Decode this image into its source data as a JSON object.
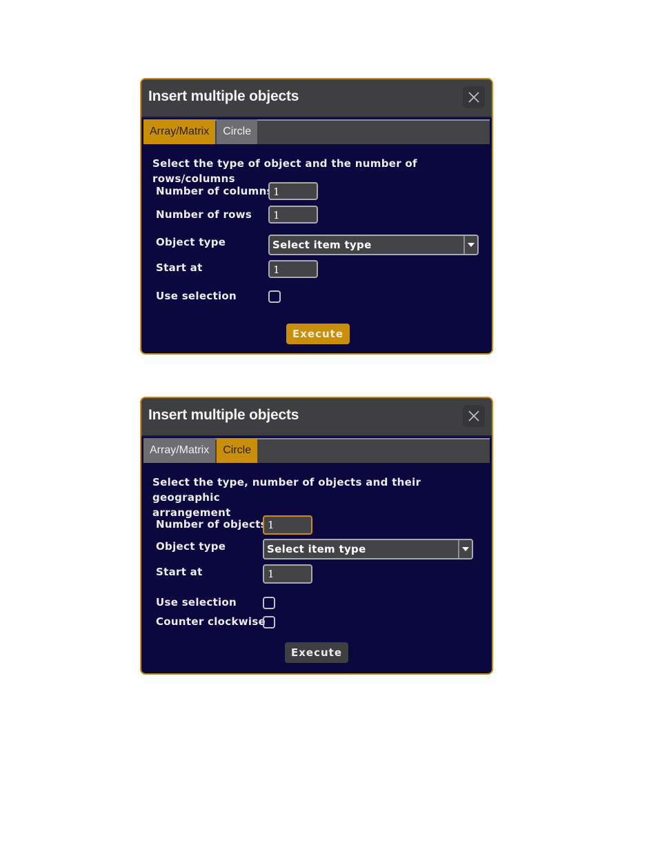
{
  "dialogs": [
    {
      "title": "Insert multiple objects",
      "close_icon": "close-icon",
      "tabs": [
        {
          "label": "Array/Matrix",
          "active": true
        },
        {
          "label": "Circle",
          "active": false
        }
      ],
      "description": "Select the type of object and the number of rows/columns",
      "fields": {
        "columns": {
          "label": "Number of columns",
          "value": "1"
        },
        "rows": {
          "label": "Number of rows",
          "value": "1"
        },
        "object_type": {
          "label": "Object type",
          "selected": "Select item type"
        },
        "start_at": {
          "label": "Start at",
          "value": "1"
        },
        "use_selection": {
          "label": "Use selection",
          "checked": false
        }
      },
      "execute_label": "Execute"
    },
    {
      "title": "Insert multiple objects",
      "close_icon": "close-icon",
      "tabs": [
        {
          "label": "Array/Matrix",
          "active": false
        },
        {
          "label": "Circle",
          "active": true
        }
      ],
      "description_line1": "Select the type, number of objects and their geographic",
      "description_line2": "arrangement",
      "fields": {
        "num_objects": {
          "label": "Number of objects",
          "value": "1"
        },
        "object_type": {
          "label": "Object type",
          "selected": "Select item type"
        },
        "start_at": {
          "label": "Start at",
          "value": "1"
        },
        "use_selection": {
          "label": "Use selection",
          "checked": false
        },
        "counter_clockwise": {
          "label": "Counter clockwise",
          "checked": false
        }
      },
      "execute_label": "Execute"
    }
  ],
  "colors": {
    "accent": "#c98e0a",
    "body_bg": "#0b0840",
    "titlebar_bg": "#3f3f42",
    "inactive_tab": "#6d6d72"
  }
}
